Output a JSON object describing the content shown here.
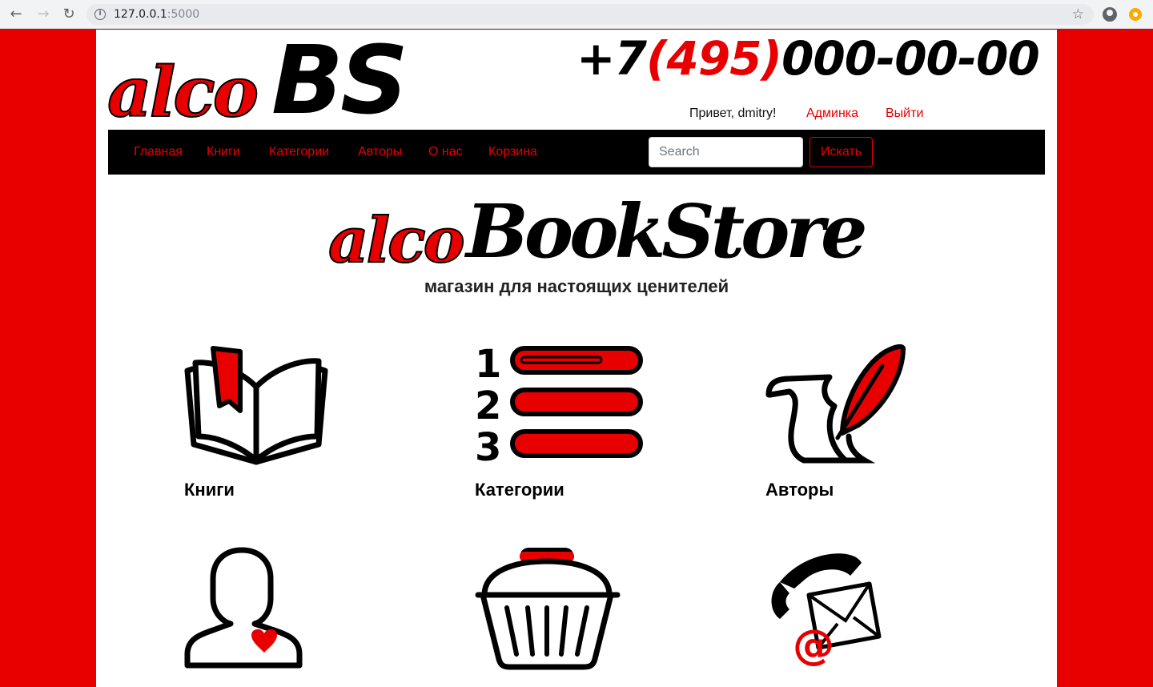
{
  "browser": {
    "url_host": "127.0.0.1",
    "url_port": ":5000"
  },
  "header": {
    "logo_part1": "alco",
    "logo_part2": "BS",
    "phone_prefix": "+7",
    "phone_code": "(495)",
    "phone_number": "000-00-00",
    "greeting": "Привет, dmitry!",
    "admin_link": "Админка",
    "logout_link": "Выйти"
  },
  "nav": {
    "items": [
      {
        "label": "Главная"
      },
      {
        "label": "Книги"
      },
      {
        "label": "Категории"
      },
      {
        "label": "Авторы"
      },
      {
        "label": "О нас"
      },
      {
        "label": "Корзина"
      }
    ],
    "search_placeholder": "Search",
    "search_button": "Искать"
  },
  "hero": {
    "logo_part1": "alco",
    "logo_part2": "BookStore",
    "tagline": "магазин для настоящих ценителей"
  },
  "tiles": [
    {
      "label": "Книги",
      "icon": "open-book-icon"
    },
    {
      "label": "Категории",
      "icon": "numbered-list-icon"
    },
    {
      "label": "Авторы",
      "icon": "quill-scroll-icon"
    },
    {
      "label": "",
      "icon": "user-heart-icon"
    },
    {
      "label": "",
      "icon": "basket-icon"
    },
    {
      "label": "",
      "icon": "contact-icon"
    }
  ],
  "colors": {
    "accent": "#e80000",
    "background": "#ffffff",
    "navbar": "#000000"
  }
}
